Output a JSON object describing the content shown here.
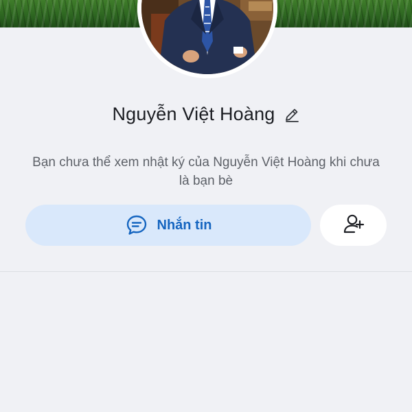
{
  "profile": {
    "name": "Nguyễn Việt Hoàng",
    "privacy_notice": "Bạn chưa thể xem nhật ký của Nguyễn Việt Hoàng khi chưa là bạn bè"
  },
  "actions": {
    "message_label": "Nhắn tin",
    "message_icon": "chat-bubble-icon",
    "add_friend_icon": "add-friend-icon"
  },
  "colors": {
    "accent": "#1565c0",
    "message_button_bg": "#d9e8fb",
    "page_bg": "#f0f1f5"
  }
}
